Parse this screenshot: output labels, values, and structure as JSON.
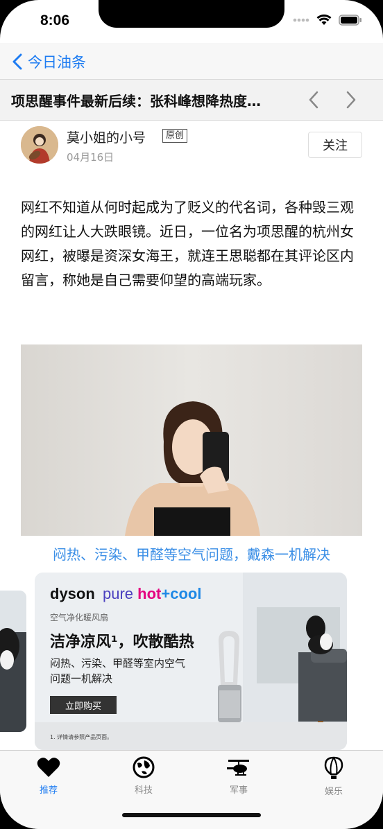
{
  "status": {
    "time": "8:06"
  },
  "nav": {
    "back_label": "今日油条"
  },
  "article": {
    "title": "项思醒事件最新后续：张科峰想降热度…",
    "author": "莫小姐的小号",
    "badge": "原创",
    "date": "04月16日",
    "follow_label": "关注",
    "body": "网红不知道从何时起成为了贬义的代名词，各种毁三观的网红让人大跌眼镜。近日，一位名为项思醒的杭州女网红，被曝是资深女海王，就连王思聪都在其评论区内留言，称她是自己需要仰望的高端玩家。"
  },
  "ad": {
    "title": "闷热、污染、甲醛等空气问题，戴森一机解决",
    "brand": "dyson",
    "tagline_p1": "pure ",
    "tagline_p2": "hot",
    "tagline_p3": "+cool",
    "sub": "空气净化暖风扇",
    "headline": "洁净凉风¹，吹散酷热",
    "desc": "闷热、污染、甲醛等室内空气问题一机解决",
    "buy_label": "立即购买",
    "footnote": "1. 详情请参照产品页面。"
  },
  "tabs": [
    {
      "label": "推荐",
      "icon": "heart-icon",
      "active": true
    },
    {
      "label": "科技",
      "icon": "globe-icon",
      "active": false
    },
    {
      "label": "军事",
      "icon": "helicopter-icon",
      "active": false
    },
    {
      "label": "娱乐",
      "icon": "balloon-icon",
      "active": false
    }
  ],
  "colors": {
    "accent": "#1e7cf2",
    "ad_title": "#3a8ee6"
  }
}
